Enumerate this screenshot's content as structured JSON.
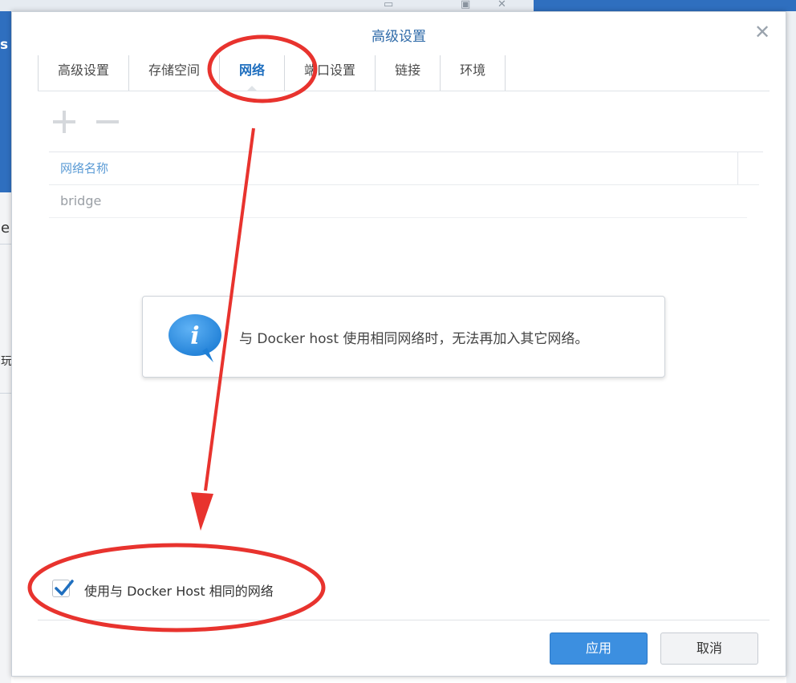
{
  "dialog": {
    "title": "高级设置",
    "close_glyph": "✕"
  },
  "tabs": [
    {
      "label": "高级设置"
    },
    {
      "label": "存储空间"
    },
    {
      "label": "网络",
      "active": true
    },
    {
      "label": "端口设置"
    },
    {
      "label": "链接"
    },
    {
      "label": "环境"
    }
  ],
  "toolbar": {
    "add_icon": "plus-icon",
    "remove_icon": "minus-icon"
  },
  "grid": {
    "column_header": "网络名称",
    "rows": [
      {
        "name": "bridge"
      }
    ]
  },
  "info": {
    "icon": "info-bubble-icon",
    "icon_glyph": "i",
    "message": "与 Docker host 使用相同网络时，无法再加入其它网络。"
  },
  "options": {
    "use_host_network_label": "使用与 Docker Host 相同的网络",
    "use_host_network_checked": true
  },
  "footer": {
    "apply_label": "应用",
    "cancel_label": "取消"
  },
  "background": {
    "sidebar_fragments": [
      "e",
      "玩"
    ],
    "top_letter": "s"
  },
  "colors": {
    "accent": "#1f6fbf",
    "apply_button": "#3c8fe0",
    "annotation_red": "#e8332e",
    "header_text": "#5b9bd5"
  }
}
